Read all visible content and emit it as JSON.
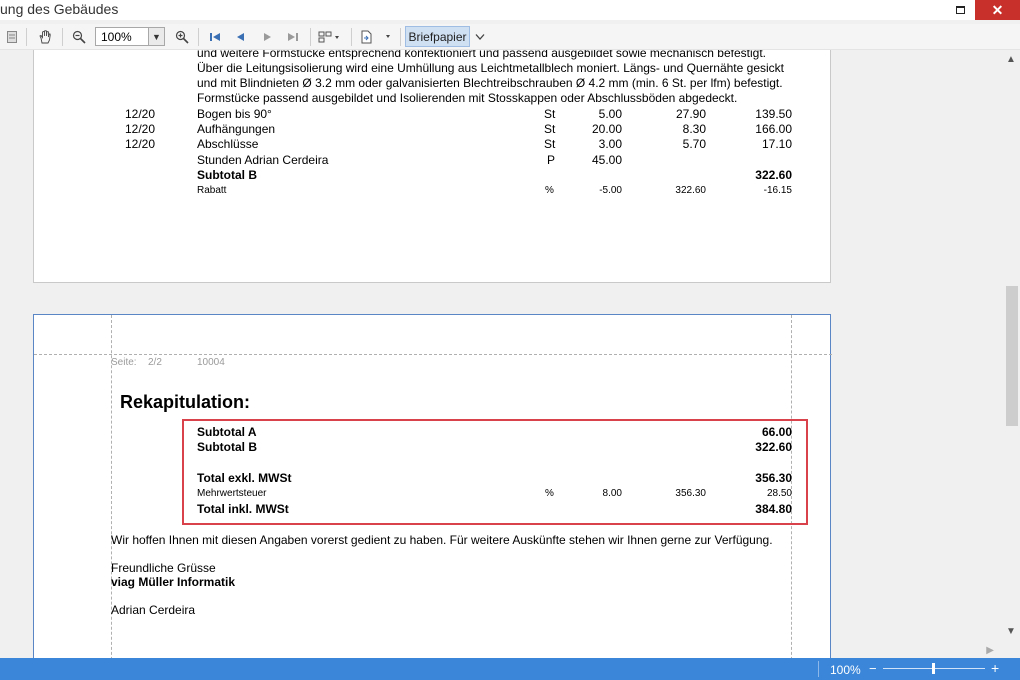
{
  "window": {
    "title": "ung des Gebäudes",
    "close_glyph": "✕"
  },
  "toolbar": {
    "zoom_value": "100%",
    "letterhead_label": "Briefpapier"
  },
  "page1": {
    "description_lines": [
      "und weitere Formstücke entsprechend konfektioniert und passend ausgebildet sowie mechanisch befestigt.",
      "Über die Leitungsisolierung wird eine Umhüllung aus Leichtmetallblech moniert. Längs- und Quernähte gesickt",
      "und mit Blindnieten Ø 3.2 mm oder galvanisierten Blechtreibschrauben Ø 4.2 mm (min. 6 St. per lfm) befestigt.",
      "Formstücke passend ausgebildet und Isolierenden mit Stosskappen oder Abschlussböden abgedeckt."
    ],
    "rows": [
      {
        "pos": "12/20",
        "desc": "Bogen bis 90°",
        "unit": "St",
        "qty": "5.00",
        "price": "27.90",
        "total": "139.50"
      },
      {
        "pos": "12/20",
        "desc": "Aufhängungen",
        "unit": "St",
        "qty": "20.00",
        "price": "8.30",
        "total": "166.00"
      },
      {
        "pos": "12/20",
        "desc": "Abschlüsse",
        "unit": "St",
        "qty": "3.00",
        "price": "5.70",
        "total": "17.10"
      },
      {
        "pos": "",
        "desc": "Stunden Adrian Cerdeira",
        "unit": "P",
        "qty": "45.00",
        "price": "",
        "total": ""
      }
    ],
    "subtotal_label": "Subtotal B",
    "subtotal_value": "322.60",
    "discount": {
      "label": "Rabatt",
      "unit": "%",
      "qty": "-5.00",
      "base": "322.60",
      "total": "-16.15"
    }
  },
  "page2": {
    "page_label": "Seite:",
    "page_number": "2/2",
    "doc_number": "10004",
    "heading": "Rekapitulation:",
    "subtotal_a_label": "Subtotal A",
    "subtotal_a_value": "66.00",
    "subtotal_b_label": "Subtotal B",
    "subtotal_b_value": "322.60",
    "total_excl_label": "Total exkl. MWSt",
    "total_excl_value": "356.30",
    "vat_label": "Mehrwertsteuer",
    "vat_unit": "%",
    "vat_rate": "8.00",
    "vat_base": "356.30",
    "vat_value": "28.50",
    "total_incl_label": "Total inkl. MWSt",
    "total_incl_value": "384.80",
    "closing_text": "Wir hoffen Ihnen mit diesen Angaben vorerst gedient zu haben. Für weitere Auskünfte stehen wir Ihnen gerne zur Verfügung.",
    "greeting": "Freundliche Grüsse",
    "company": "viag Müller Informatik",
    "signer": "Adrian Cerdeira"
  },
  "statusbar": {
    "zoom": "100%",
    "minus": "−",
    "plus": "+"
  },
  "colors": {
    "statusbar": "#3b86d8",
    "highlight": "#d9424b",
    "close_button": "#c7302b"
  }
}
